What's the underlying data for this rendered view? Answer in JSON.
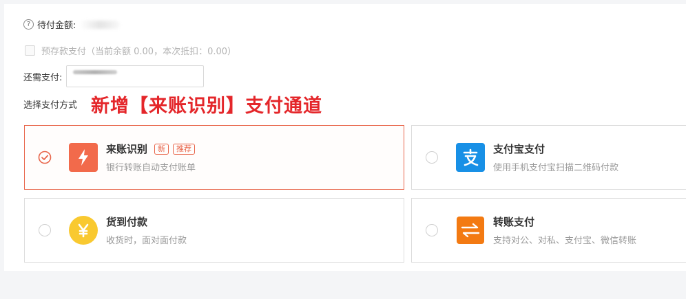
{
  "amount_due": {
    "label": "待付金额:"
  },
  "prepaid": {
    "label": "预存款支付（当前余额 0.00，本次抵扣：0.00）"
  },
  "remaining": {
    "label": "还需支付:"
  },
  "choose_method": {
    "label": "选择支付方式"
  },
  "announcement": "新增【来账识别】支付通道",
  "methods": [
    {
      "title": "来账识别",
      "desc": "银行转账自动支付账单",
      "tags": [
        "新",
        "推荐"
      ],
      "selected": true,
      "icon": "lightning-icon",
      "color": "#f26a4b"
    },
    {
      "title": "支付宝支付",
      "desc": "使用手机支付宝扫描二维码付款",
      "selected": false,
      "icon": "alipay-icon",
      "color": "#1890e6"
    },
    {
      "title": "货到付款",
      "desc": "收货时，面对面付款",
      "selected": false,
      "icon": "yuan-icon",
      "color": "#f9c930"
    },
    {
      "title": "转账支付",
      "desc": "支持对公、对私、支付宝、微信转账",
      "selected": false,
      "icon": "transfer-arrows-icon",
      "color": "#f37a12"
    }
  ],
  "accent_color": "#e8654a"
}
